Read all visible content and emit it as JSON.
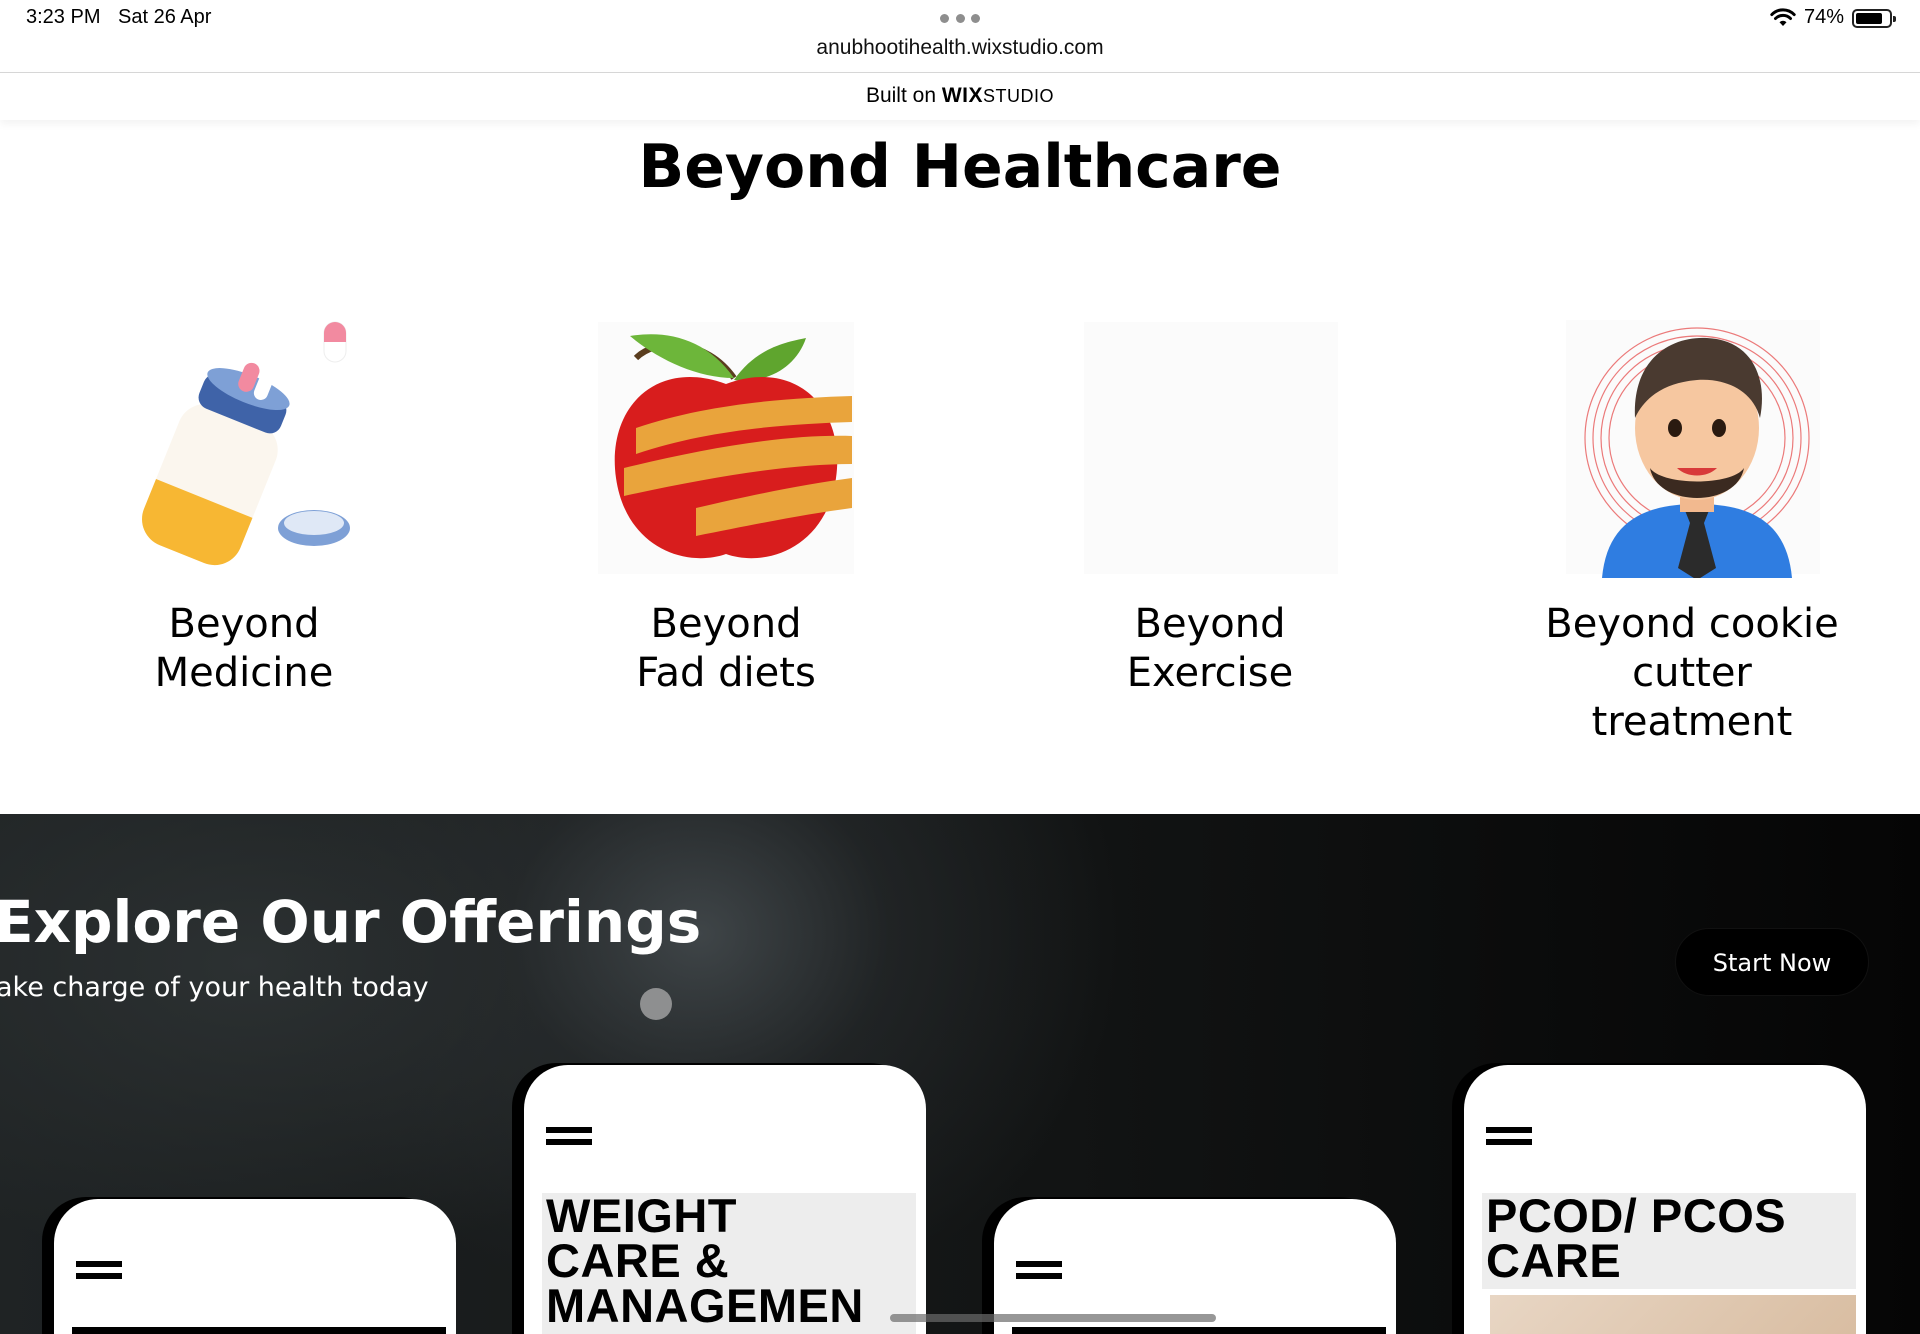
{
  "status_bar": {
    "time": "3:23 PM",
    "date": "Sat 26 Apr",
    "url": "anubhootihealth.wixstudio.com",
    "battery": "74%",
    "icons": [
      "more-dots-icon",
      "wifi-icon",
      "battery-icon"
    ]
  },
  "built_bar": {
    "prefix": "Built on",
    "wix": "WIX",
    "studio": "STUDIO"
  },
  "beyond": {
    "title": "Beyond Healthcare",
    "cards": [
      {
        "line1": "Beyond",
        "line2": "Medicine",
        "line3": "",
        "image": "medicine-bottle-illustration"
      },
      {
        "line1": "Beyond",
        "line2": "Fad diets",
        "line3": "",
        "image": "apple-measuring-tape-illustration"
      },
      {
        "line1": "Beyond",
        "line2": "Exercise",
        "line3": "",
        "image": "blank-image"
      },
      {
        "line1": "Beyond cookie",
        "line2": "cutter",
        "line3": "treatment",
        "image": "doctor-avatar-illustration"
      }
    ]
  },
  "offerings": {
    "title": "Explore Our Offerings",
    "subtitle": "ake charge of your health today",
    "start_button": "Start Now",
    "cards": [
      {
        "title": ""
      },
      {
        "title_lines": [
          "WEIGHT",
          "CARE &",
          "MANAGEMEN"
        ]
      },
      {
        "title": ""
      },
      {
        "title_lines": [
          "PCOD/ PCOS",
          "CARE"
        ]
      }
    ]
  },
  "colors": {
    "accent_pill": "#f28aa0",
    "bottle": "#f7b733",
    "shirt": "#2f7de1",
    "dark_bg": "#121414"
  }
}
